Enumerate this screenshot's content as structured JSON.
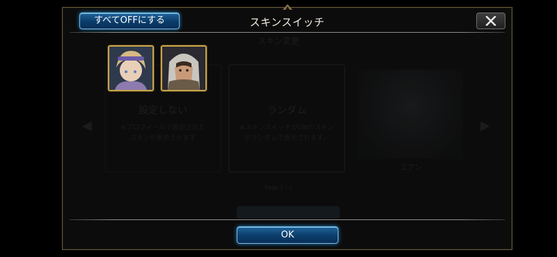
{
  "dialog": {
    "title": "スキンスイッチ",
    "all_off_label": "すべてOFFにする",
    "ok_label": "OK"
  },
  "icons": {
    "close": "close-x-icon"
  },
  "skins": [
    {
      "name": "skin-icon-1",
      "selected": true
    },
    {
      "name": "skin-icon-2",
      "selected": true
    }
  ],
  "background_dialog": {
    "title": "スキン変更",
    "cards": [
      {
        "title": "設定しない",
        "desc": "※プロフィールで設定された\nスキンが表示されます"
      },
      {
        "title": "ランダム",
        "desc": "※スキンスイッチがONのスキン\nがランダムで表示されます。"
      }
    ],
    "portrait_name": "ユアン",
    "page_label": "Page 1 / 2"
  },
  "colors": {
    "accent_blue": "#0b3c69",
    "frame_gold": "#c9a54a"
  }
}
